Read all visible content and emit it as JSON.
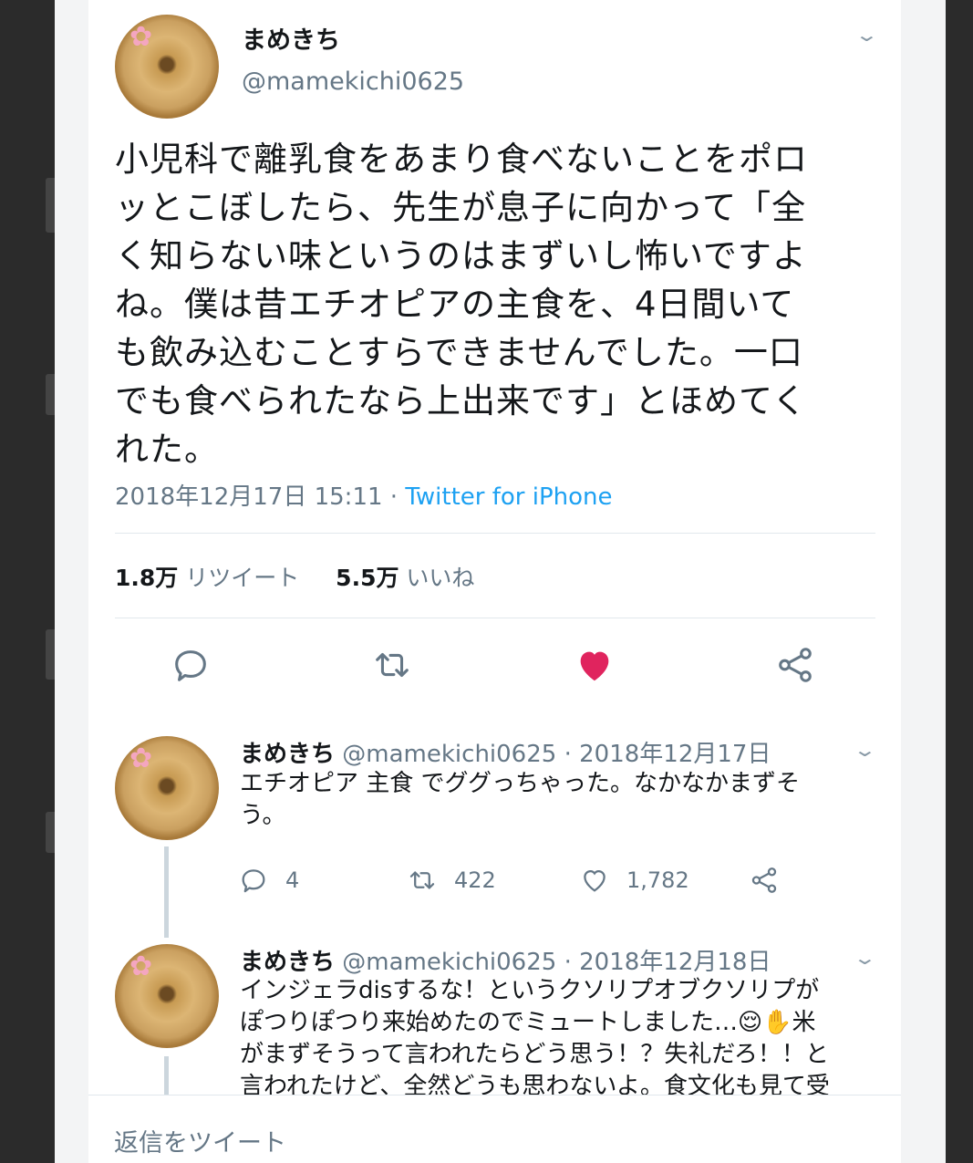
{
  "main_tweet": {
    "display_name": "まめきち",
    "handle": "@mamekichi0625",
    "text": "小児科で離乳食をあまり食べないことをポロッとこぼしたら、先生が息子に向かって「全く知らない味というのはまずいし怖いですよね。僕は昔エチオピアの主食を、4日間いても飲み込むことすらできませんでした。一口でも食べられたなら上出来です」とほめてくれた。",
    "lines": [
      "小児科で離乳食をあまり食べないことをポロ",
      "ッとこぼしたら、先生が息子に向かって「全",
      "く知らない味というのはまずいし怖いですよ",
      "ね。僕は昔エチオピアの主食を、4日間いて",
      "も飲み込むことすらできませんでした。一口",
      "でも食べられたなら上出来です」とほめてく",
      "れた。"
    ],
    "timestamp": "2018年12月17日 15:11",
    "separator": " · ",
    "source": "Twitter for iPhone",
    "retweet_count": "1.8万",
    "retweet_label": "リツイート",
    "like_count": "5.5万",
    "like_label": "いいね",
    "liked": true,
    "like_color": "#e0245e"
  },
  "replies": [
    {
      "display_name": "まめきち",
      "handle": "@mamekichi0625",
      "date": "· 2018年12月17日",
      "text": "エチオピア 主食 でググっちゃった。なかなかまずそう。",
      "lines": [
        "エチオピア 主食 でググっちゃった。なかなかまずそ",
        "う。"
      ],
      "reply_count": "4",
      "retweet_count": "422",
      "like_count": "1,782"
    },
    {
      "display_name": "まめきち",
      "handle": "@mamekichi0625",
      "date": "· 2018年12月18日",
      "lines": [
        "インジェラdisするな！というクソリプオブクソリプが",
        "ぽつりぽつり来始めたのでミュートしました…😌✋米",
        "がまずそうって言われたらどう思う！？失礼だろ！！と",
        "言われたけど、全然どうも思わないよ。食文化も見て受"
      ]
    }
  ],
  "compose": {
    "placeholder": "返信をツイート"
  },
  "icons": {
    "reply": "reply-icon",
    "retweet": "retweet-icon",
    "like": "heart-icon",
    "share": "share-icon",
    "more": "chevron-down-icon"
  },
  "colors": {
    "link": "#1da1f2",
    "secondary_text": "#657786",
    "like": "#e0245e"
  }
}
